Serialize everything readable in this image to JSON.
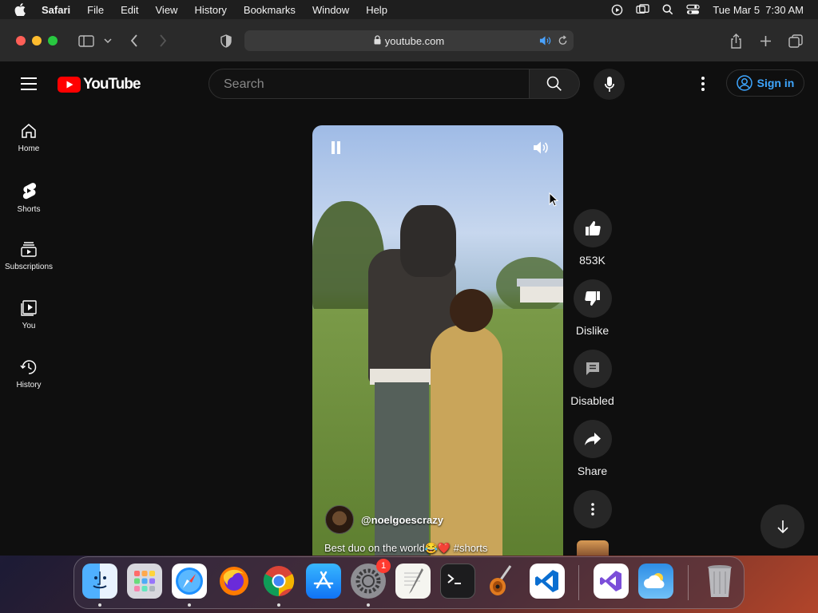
{
  "menubar": {
    "app_name": "Safari",
    "items": [
      "File",
      "Edit",
      "View",
      "History",
      "Bookmarks",
      "Window",
      "Help"
    ],
    "datetime": "Tue Mar 5  7:30 AM",
    "icons": [
      "apple-icon",
      "play-circle-icon",
      "screen-mirroring-icon",
      "spotlight-search-icon",
      "control-center-icon"
    ]
  },
  "safari": {
    "url": "youtube.com"
  },
  "youtube": {
    "brand": "YouTube",
    "search_placeholder": "Search",
    "sign_in": "Sign in",
    "sidebar": [
      {
        "label": "Home",
        "icon": "home-icon"
      },
      {
        "label": "Shorts",
        "icon": "shorts-icon"
      },
      {
        "label": "Subscriptions",
        "icon": "subscriptions-icon"
      },
      {
        "label": "You",
        "icon": "you-icon"
      },
      {
        "label": "History",
        "icon": "history-icon"
      }
    ],
    "short": {
      "channel": "@noelgoescrazy",
      "caption": "Best duo on the world😂❤️ #shorts"
    },
    "actions": {
      "likes": "853K",
      "dislike": "Dislike",
      "comments": "Disabled",
      "share": "Share"
    }
  },
  "dock": {
    "apps": [
      "Finder",
      "Launchpad",
      "Safari",
      "Firefox",
      "Chrome",
      "App Store",
      "System Settings",
      "TextEdit",
      "Terminal",
      "GarageBand",
      "Visual Studio Code",
      "Visual Studio",
      "Weather",
      "Trash"
    ],
    "settings_badge": "1"
  },
  "colors": {
    "youtube_red": "#ff0000",
    "link_blue": "#3ea6ff",
    "background": "#0f0f0f"
  }
}
